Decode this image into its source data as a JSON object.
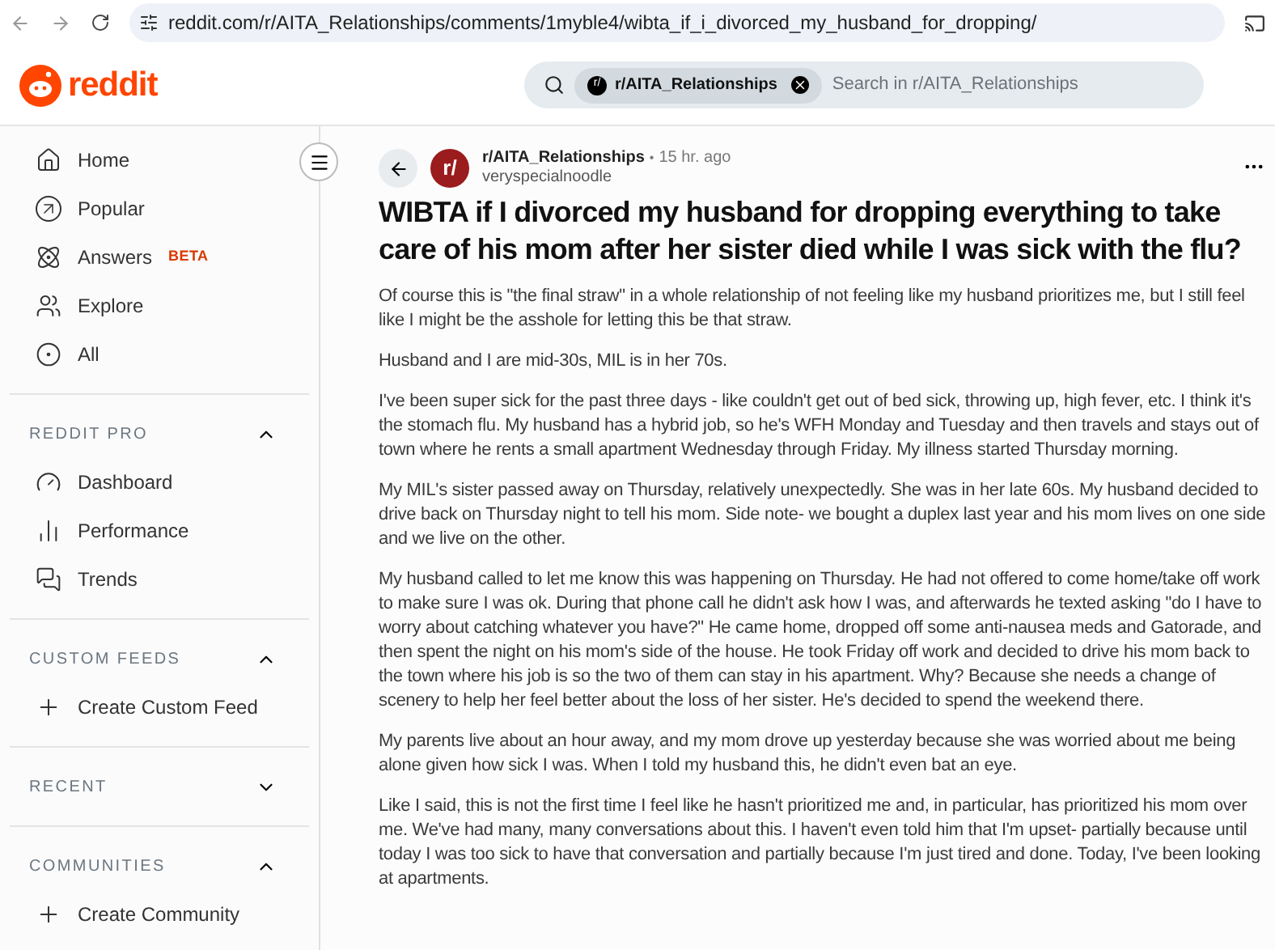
{
  "browser": {
    "url": "reddit.com/r/AITA_Relationships/comments/1myble4/wibta_if_i_divorced_my_husband_for_dropping/"
  },
  "header": {
    "logo": "reddit",
    "chip_icon": "r/",
    "search_chip": "r/AITA_Relationships",
    "search_placeholder": "Search in r/AITA_Relationships"
  },
  "sidebar": {
    "items": [
      {
        "kind": "home",
        "label": "Home"
      },
      {
        "kind": "popular",
        "label": "Popular"
      },
      {
        "kind": "answers",
        "label": "Answers",
        "badge": "BETA"
      },
      {
        "kind": "explore",
        "label": "Explore"
      },
      {
        "kind": "all",
        "label": "All"
      }
    ],
    "sections": [
      {
        "title": "REDDIT PRO",
        "expanded": true,
        "items": [
          {
            "kind": "dashboard",
            "label": "Dashboard"
          },
          {
            "kind": "performance",
            "label": "Performance"
          },
          {
            "kind": "trends",
            "label": "Trends"
          }
        ]
      },
      {
        "title": "CUSTOM FEEDS",
        "expanded": true,
        "items": [
          {
            "kind": "plus",
            "label": "Create Custom Feed"
          }
        ]
      },
      {
        "title": "RECENT",
        "expanded": false
      },
      {
        "title": "COMMUNITIES",
        "expanded": true,
        "items": [
          {
            "kind": "plus",
            "label": "Create Community"
          }
        ]
      }
    ]
  },
  "post": {
    "community_icon": "r/",
    "community": "r/AITA_Relationships",
    "separator": "•",
    "time": "15 hr. ago",
    "author": "veryspecialnoodle",
    "title": "WIBTA if I divorced my husband for dropping everything to take care of his mom after her sister died while I was sick with the flu?",
    "paragraphs": [
      "Of course this is \"the final straw\" in a whole relationship of not feeling like my husband prioritizes me, but I still feel like I might be the asshole for letting this be that straw.",
      "Husband and I are mid-30s, MIL is in her 70s.",
      "I've been super sick for the past three days - like couldn't get out of bed sick, throwing up, high fever, etc. I think it's the stomach flu. My husband has a hybrid job, so he's WFH Monday and Tuesday and then travels and stays out of town where he rents a small apartment Wednesday through Friday. My illness started Thursday morning.",
      "My MIL's sister passed away on Thursday, relatively unexpectedly. She was in her late 60s. My husband decided to drive back on Thursday night to tell his mom. Side note- we bought a duplex last year and his mom lives on one side and we live on the other.",
      "My husband called to let me know this was happening on Thursday. He had not offered to come home/take off work to make sure I was ok. During that phone call he didn't ask how I was, and afterwards he texted asking \"do I have to worry about catching whatever you have?\" He came home, dropped off some anti-nausea meds and Gatorade, and then spent the night on his mom's side of the house. He took Friday off work and decided to drive his mom back to the town where his job is so the two of them can stay in his apartment. Why? Because she needs a change of scenery to help her feel better about the loss of her sister. He's decided to spend the weekend there.",
      "My parents live about an hour away, and my mom drove up yesterday because she was worried about me being alone given how sick I was. When I told my husband this, he didn't even bat an eye.",
      "Like I said, this is not the first time I feel like he hasn't prioritized me and, in particular, has prioritized his mom over me. We've had many, many conversations about this. I haven't even told him that I'm upset- partially because until today I was too sick to have that conversation and partially because I'm just tired and done. Today, I've been looking at apartments."
    ]
  }
}
